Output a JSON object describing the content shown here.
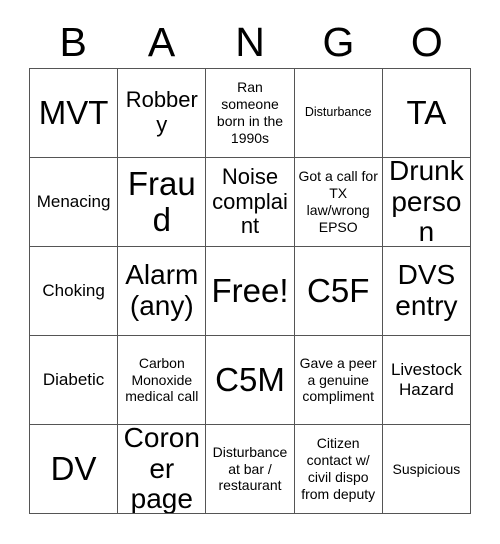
{
  "card": {
    "title": "BANGO",
    "header_letters": [
      "B",
      "A",
      "N",
      "G",
      "O"
    ],
    "grid_size": "5x5",
    "colors": {
      "background": "#ffffff",
      "text": "#000000",
      "border": "#555555"
    },
    "rows": [
      [
        {
          "text": "MVT",
          "size": "xxl"
        },
        {
          "text": "Robbery",
          "size": "lg"
        },
        {
          "text": "Ran someone born in the 1990s",
          "size": "sm"
        },
        {
          "text": "Disturbance",
          "size": "xs"
        },
        {
          "text": "TA",
          "size": "xxl"
        }
      ],
      [
        {
          "text": "Menacing",
          "size": "md"
        },
        {
          "text": "Fraud",
          "size": "xxl"
        },
        {
          "text": "Noise complaint",
          "size": "lg"
        },
        {
          "text": "Got a call for TX law/wrong EPSO",
          "size": "sm"
        },
        {
          "text": "Drunk person",
          "size": "xl"
        }
      ],
      [
        {
          "text": "Choking",
          "size": "md"
        },
        {
          "text": "Alarm (any)",
          "size": "xl"
        },
        {
          "text": "Free!",
          "size": "xxl"
        },
        {
          "text": "C5F",
          "size": "xxl"
        },
        {
          "text": "DVS entry",
          "size": "xl"
        }
      ],
      [
        {
          "text": "Diabetic",
          "size": "md"
        },
        {
          "text": "Carbon Monoxide medical call",
          "size": "sm"
        },
        {
          "text": "C5M",
          "size": "xxl"
        },
        {
          "text": "Gave a peer a genuine compliment",
          "size": "sm"
        },
        {
          "text": "Livestock Hazard",
          "size": "md"
        }
      ],
      [
        {
          "text": "DV",
          "size": "xxl"
        },
        {
          "text": "Coroner page",
          "size": "xl"
        },
        {
          "text": "Disturbance at bar / restaurant",
          "size": "sm"
        },
        {
          "text": "Citizen contact w/ civil dispo from deputy",
          "size": "sm"
        },
        {
          "text": "Suspicious",
          "size": "sm"
        }
      ]
    ]
  }
}
